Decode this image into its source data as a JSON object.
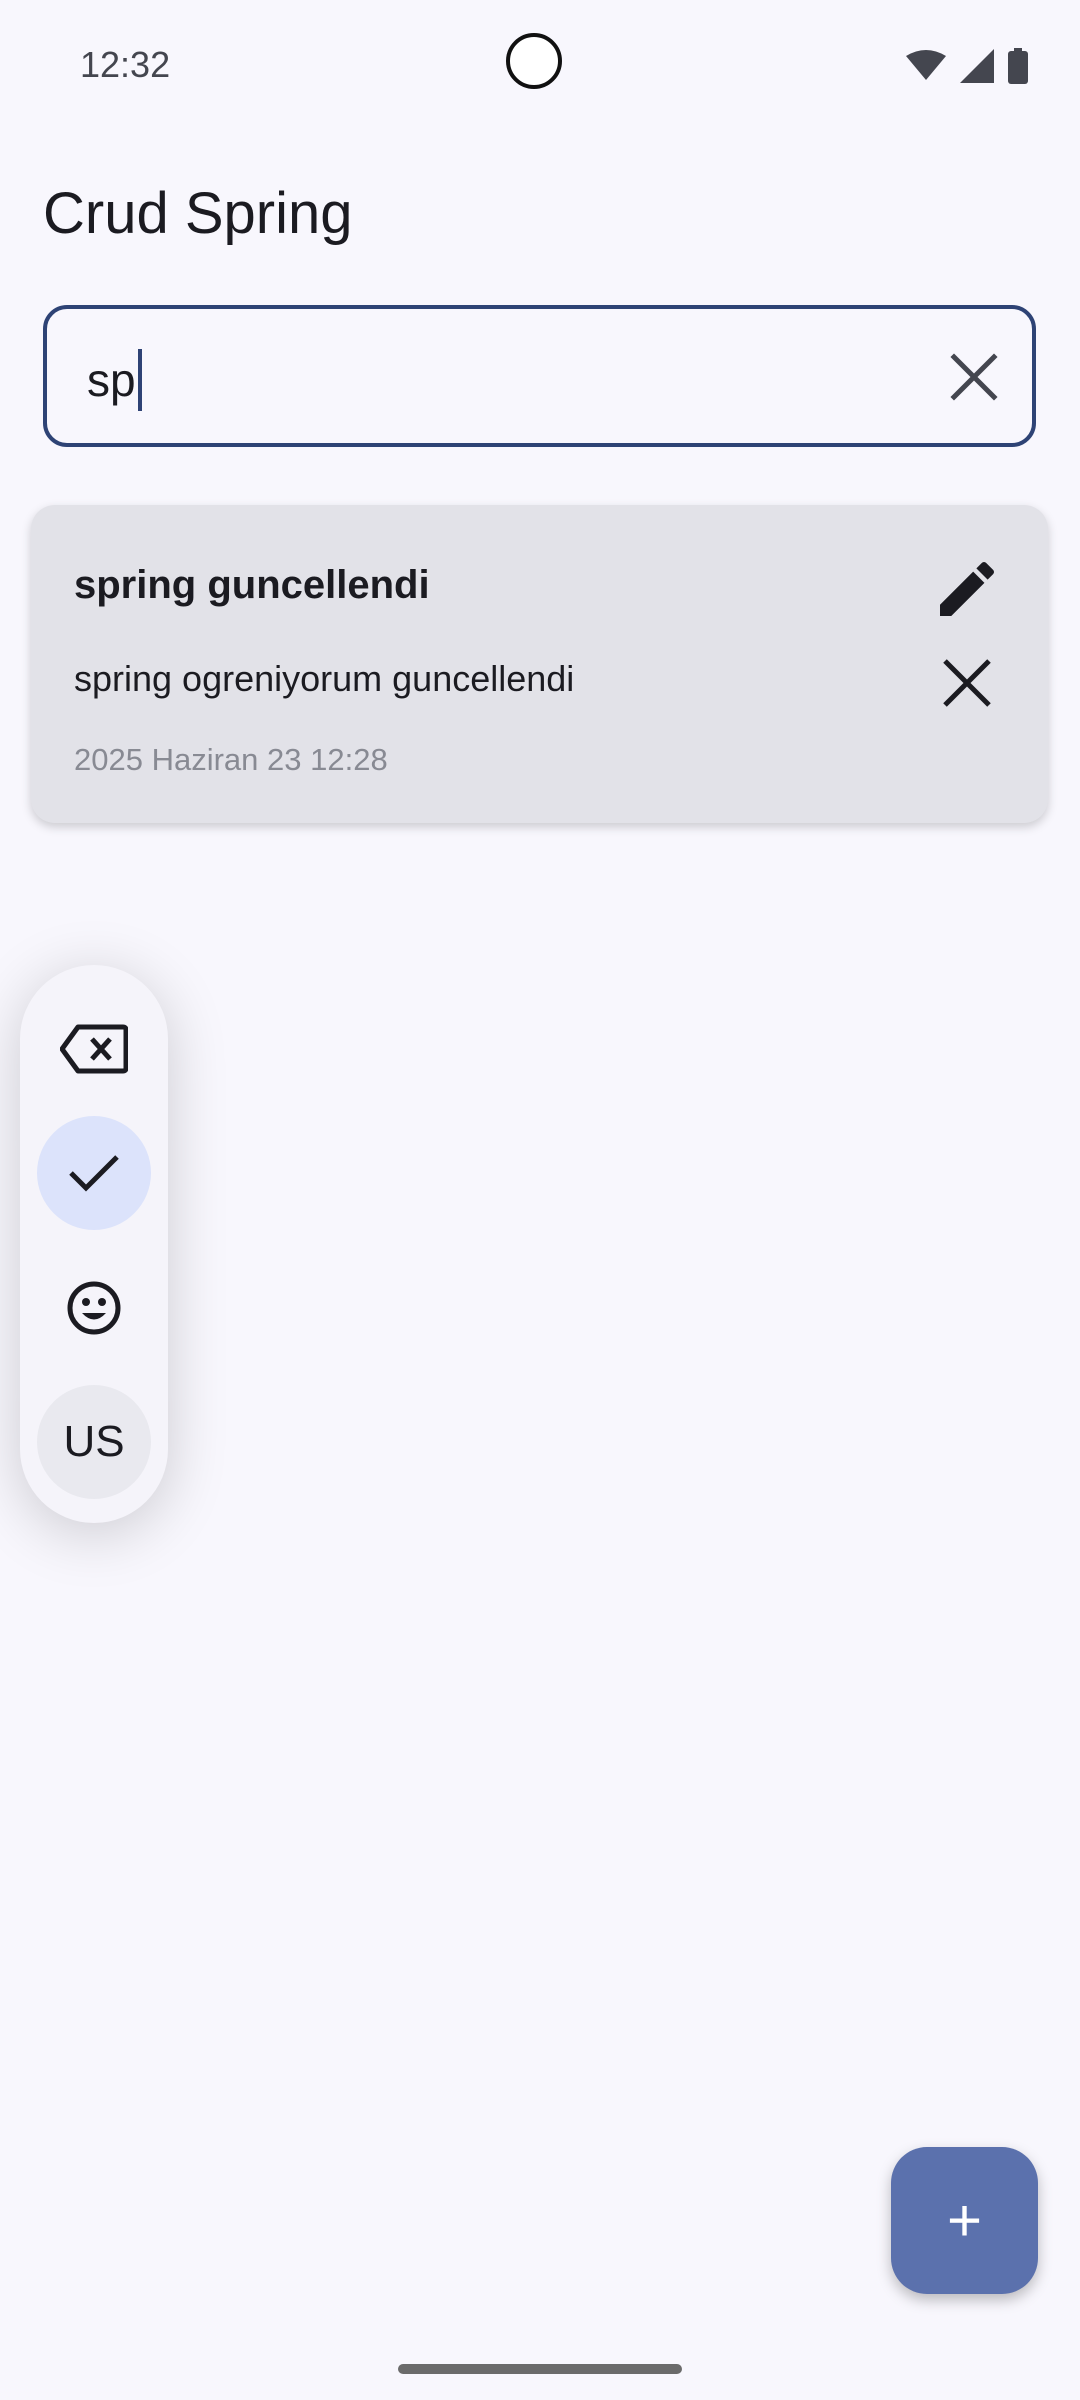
{
  "status_bar": {
    "time": "12:32",
    "icons": [
      "wifi-icon",
      "signal-icon",
      "battery-icon"
    ]
  },
  "app": {
    "title": "Crud Spring"
  },
  "search": {
    "value": "sp",
    "clear_icon": "close-icon"
  },
  "notes": [
    {
      "title": "spring guncellendi",
      "body": "spring ogreniyorum guncellendi",
      "date": "2025 Haziran 23 12:28"
    }
  ],
  "keyboard_toolbar": {
    "items": [
      "backspace-icon",
      "check-icon",
      "emoji-icon"
    ],
    "language": "US"
  },
  "fab": {
    "label": "+"
  },
  "colors": {
    "background": "#f8f7fd",
    "search_border": "#2e4375",
    "card": "#e2e2e8",
    "fab": "#5b71ad",
    "selected_chip": "#dce3fb"
  }
}
